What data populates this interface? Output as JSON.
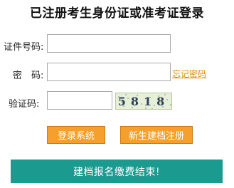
{
  "page": {
    "title": "已注册考生身份证或准考证登录"
  },
  "form": {
    "id_label": "证件号码:",
    "id_value": "",
    "password_label": "密　码:",
    "password_value": "",
    "forgot_password": "忘记密码",
    "captcha_label": "验证码:",
    "captcha_value": "",
    "captcha_image_text": "5818"
  },
  "buttons": {
    "login": "登录系统",
    "register": "新生建档注册"
  },
  "banner": {
    "text": "建档报名缴费结束!"
  },
  "colors": {
    "button_bg": "#f5a02c",
    "banner_bg": "#1b9a90",
    "link": "#e08a00"
  }
}
